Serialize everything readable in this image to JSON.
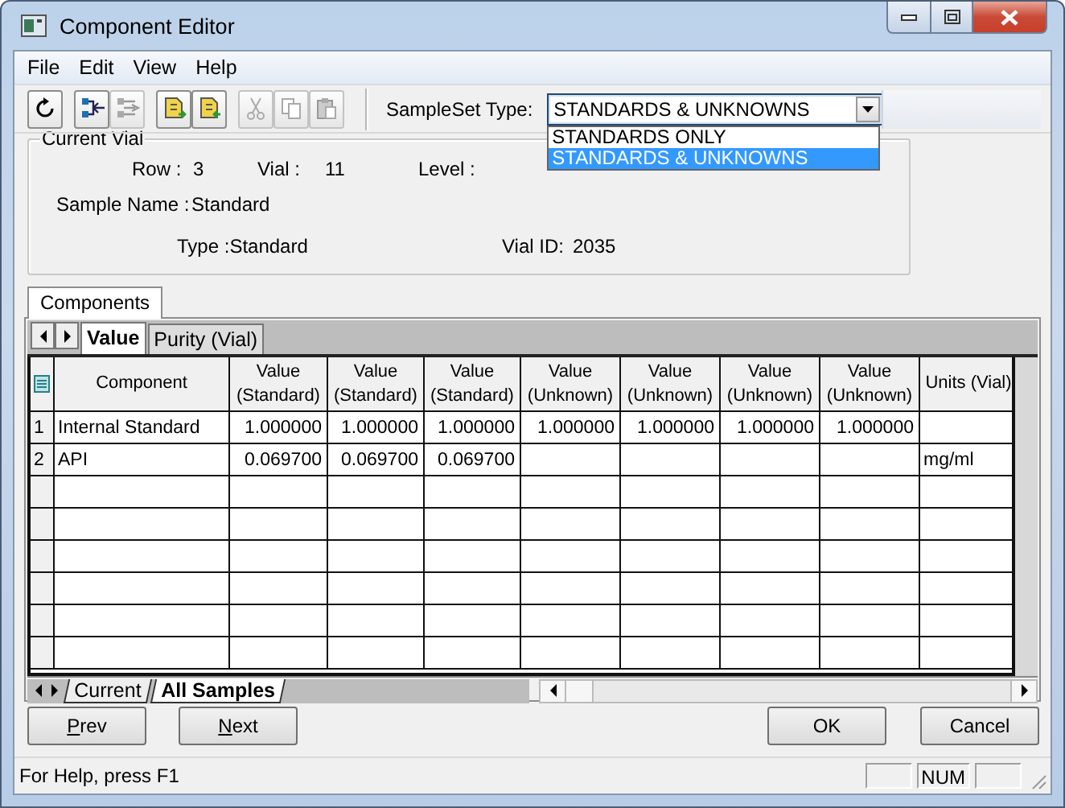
{
  "window": {
    "title": "Component Editor"
  },
  "menu": [
    "File",
    "Edit",
    "View",
    "Help"
  ],
  "toolbar": [
    {
      "kind": "refresh",
      "disabled": false
    },
    {
      "kind": "import",
      "disabled": false
    },
    {
      "kind": "export",
      "disabled": true
    },
    {
      "kind": "doc-in",
      "disabled": false
    },
    {
      "kind": "doc-out",
      "disabled": false
    },
    {
      "kind": "cut",
      "disabled": true
    },
    {
      "kind": "copy",
      "disabled": true
    },
    {
      "kind": "paste",
      "disabled": true
    }
  ],
  "sampleset_type": {
    "label": "SampleSet Type:",
    "value": "STANDARDS & UNKNOWNS",
    "expanded": true,
    "options": [
      {
        "label": "STANDARDS ONLY",
        "selected": false
      },
      {
        "label": "STANDARDS & UNKNOWNS",
        "selected": true
      }
    ]
  },
  "current_vial": {
    "title": "Current Vial",
    "rows": [
      [
        {
          "label": "Row :",
          "value": "3"
        },
        {
          "label": "Vial :",
          "value": "11"
        },
        {
          "label": "Level :"
        }
      ],
      [
        {
          "label": "Sample Name :",
          "value": "Standard"
        }
      ],
      [
        {
          "label": "Type :",
          "value": "Standard"
        },
        {
          "label": "Vial ID:",
          "value": "2035"
        }
      ]
    ]
  },
  "tabs": [
    {
      "label": "Components",
      "selected": true
    }
  ],
  "sheet_tabs": [
    {
      "label": "Value",
      "selected": true
    },
    {
      "label": "Purity (Vial)",
      "selected": false
    }
  ],
  "table": {
    "columns": [
      "Component",
      "Value (Standard)",
      "Value (Standard)",
      "Value (Standard)",
      "Value (Unknown)",
      "Value (Unknown)",
      "Value (Unknown)",
      "Value (Unknown)",
      "Units (Vial)"
    ],
    "rows": [
      {
        "number": "1",
        "cells": [
          "Internal Standard",
          "1.000000",
          "1.000000",
          "1.000000",
          "1.000000",
          "1.000000",
          "1.000000",
          "1.000000",
          null
        ]
      },
      {
        "number": "2",
        "cells": [
          "API",
          "0.069700",
          "0.069700",
          "0.069700",
          null,
          null,
          null,
          null,
          "mg/ml"
        ]
      }
    ]
  },
  "bottom_tabs": [
    {
      "label": "Current",
      "selected": false
    },
    {
      "label": "All Samples",
      "selected": true
    }
  ],
  "buttons": [
    "Prev",
    "Next",
    "OK",
    "Cancel"
  ],
  "status_bar": {
    "text": "For Help, press F1",
    "indicators": [
      "NUM"
    ]
  }
}
